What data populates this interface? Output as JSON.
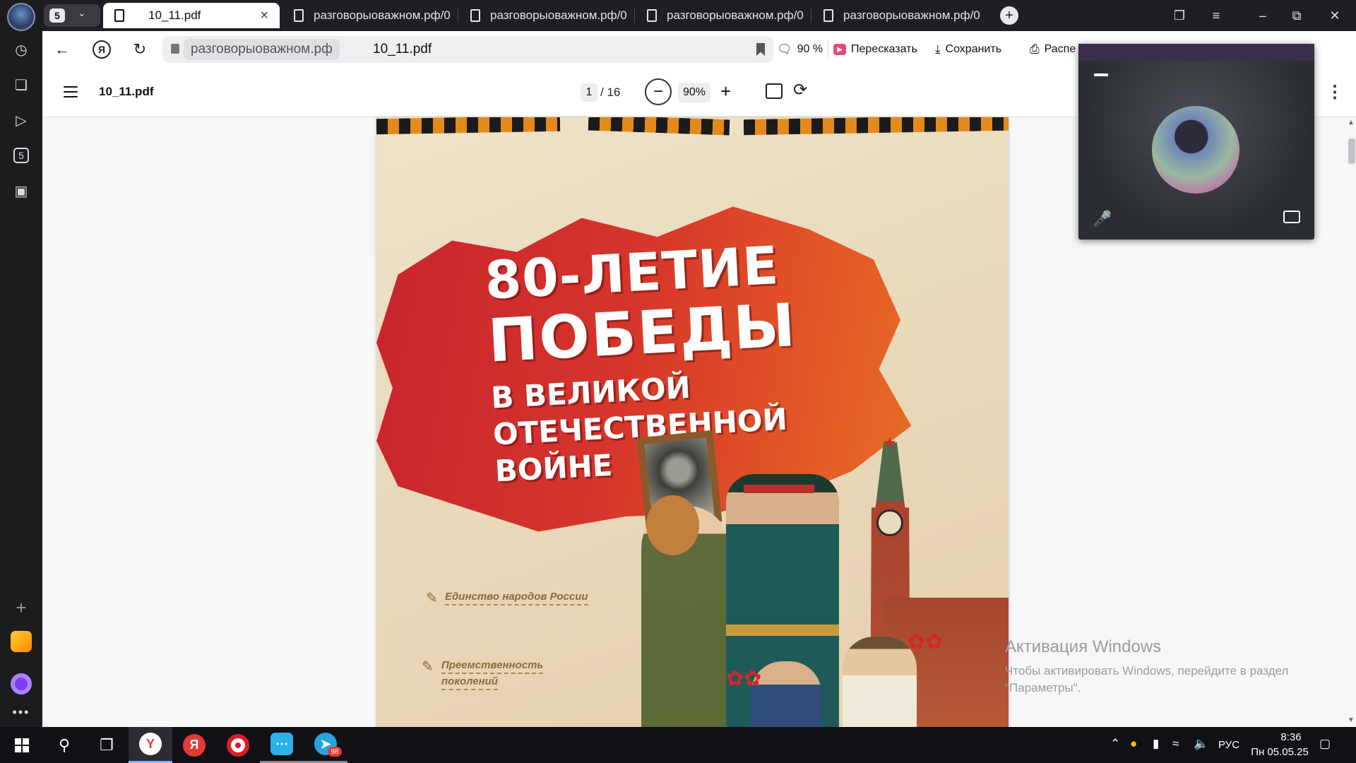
{
  "colors": {
    "accent": "#8ab4f8",
    "poster_red": "#d6352b",
    "retell_pink": "#e64a7b"
  },
  "tabs": {
    "group_count": "5",
    "active": {
      "title": "10_11.pdf"
    },
    "items": [
      {
        "title": "разговорыоважном.рф/0"
      },
      {
        "title": "разговорыоважном.рф/0"
      },
      {
        "title": "разговорыоважном.рф/0"
      },
      {
        "title": "разговорыоважном.рф/0"
      }
    ]
  },
  "address": {
    "domain": "разговорыоважном.рф",
    "page_title": "10_11.pdf",
    "zoom": "90 %",
    "retell_label": "Пересказать",
    "save_label": "Сохранить",
    "print_label": "Распе"
  },
  "pdf": {
    "file_name": "10_11.pdf",
    "page_current": "1",
    "page_total": "/ 16",
    "zoom": "90%"
  },
  "poster": {
    "line1": "80-ЛЕТИЕ",
    "line2": "ПОБЕДЫ",
    "line3": "В ВЕЛИКОЙ",
    "line4": "ОТЕЧЕСТВЕННОЙ",
    "line5": "ВОЙНЕ",
    "topic1": "Единство народов России",
    "topic2_a": "Преемственность",
    "topic2_b": "поколений"
  },
  "watermark": {
    "title": "Активация Windows",
    "text": "Чтобы активировать Windows, перейдите в раздел \"Параметры\"."
  },
  "taskbar": {
    "telegram_badge": "98",
    "language": "РУС",
    "time": "8:36",
    "date": "Пн 05.05.25"
  },
  "icons": [
    "history-icon",
    "collections-icon",
    "video-icon",
    "counter-icon",
    "screenshot-icon",
    "add-icon",
    "mail-icon",
    "alice-icon",
    "more-icon",
    "windows-start-icon",
    "search-icon",
    "task-view-icon",
    "yandex-browser-icon",
    "yandex-icon",
    "opera-icon",
    "messenger-icon",
    "telegram-icon"
  ]
}
